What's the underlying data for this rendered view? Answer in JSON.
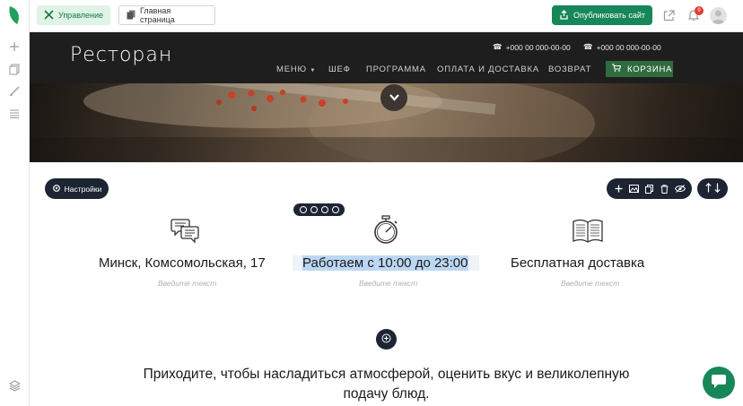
{
  "topbar": {
    "manage_label": "Управление",
    "home_label": "Главная страница",
    "publish_label": "Опубликовать сайт",
    "notifications_count": "9"
  },
  "site": {
    "logo": "Ресторан",
    "phones": [
      "+000 00 000-00-00",
      "+000 00 000-00-00"
    ],
    "nav": [
      "МЕНЮ",
      "ШЕФ",
      "ПРОГРАММА",
      "ОПЛАТА И ДОСТАВКА",
      "ВОЗВРАТ"
    ],
    "cart_label": "КОРЗИНА"
  },
  "editor": {
    "settings_label": "Настройки"
  },
  "features": [
    {
      "title": "Минск, Комсомольская, 17",
      "placeholder": "Введите текст",
      "icon": "chat-bubbles-icon"
    },
    {
      "title": "Работаем с 10:00 до 23:00",
      "placeholder": "Введите текст",
      "icon": "stopwatch-icon"
    },
    {
      "title": "Бесплатная доставка",
      "placeholder": "Введите текст",
      "icon": "open-book-icon"
    }
  ],
  "tagline": {
    "line1": "Приходите, чтобы насладиться атмосферой, оценить вкус и великолепную",
    "line2": "подачу блюд."
  },
  "colors": {
    "brand_green": "#17875a",
    "header_dark": "#1e1e1e",
    "editor_dark": "#1d2433",
    "cart_green": "#2f6b3e",
    "highlight": "#bcd7f3"
  }
}
